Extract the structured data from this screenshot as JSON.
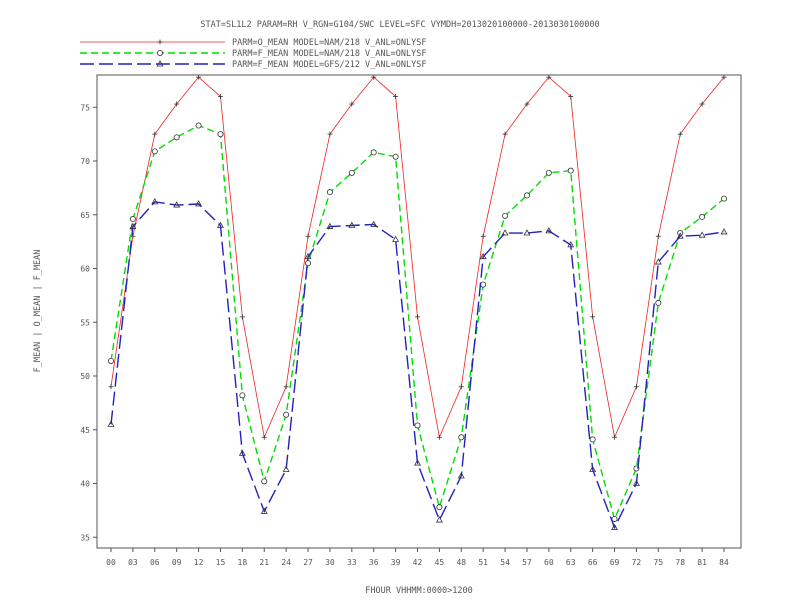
{
  "chart_data": {
    "type": "line",
    "title": "STAT=SL1L2 PARAM=RH V_RGN=G104/SWC LEVEL=SFC VYMDH=2013020100000-2013030100000",
    "xlabel": "FHOUR VHHMM:0000>1200",
    "ylabel": "F_MEAN | O_MEAN | F_MEAN",
    "legend_position": "top-left",
    "grid": false,
    "ylim": [
      34,
      78
    ],
    "yticks": [
      35,
      40,
      45,
      50,
      55,
      60,
      65,
      70,
      75
    ],
    "categories": [
      "00",
      "03",
      "06",
      "09",
      "12",
      "15",
      "18",
      "21",
      "24",
      "27",
      "30",
      "33",
      "36",
      "39",
      "42",
      "45",
      "48",
      "51",
      "54",
      "57",
      "60",
      "63",
      "66",
      "69",
      "72",
      "75",
      "78",
      "81",
      "84"
    ],
    "series": [
      {
        "name": "PARM=O_MEAN MODEL=NAM/218 V_ANL=ONLYSF",
        "color": "#ee2222",
        "dash": "solid",
        "marker": "plus",
        "values": [
          49.0,
          63.0,
          72.5,
          75.3,
          77.8,
          76.0,
          55.5,
          44.3,
          49.0,
          63.0,
          72.5,
          75.3,
          77.8,
          76.0,
          55.5,
          44.3,
          49.0,
          63.0,
          72.5,
          75.3,
          77.8,
          76.0,
          55.5,
          44.3,
          49.0,
          63.0,
          72.5,
          75.3,
          77.8
        ]
      },
      {
        "name": "PARM=F_MEAN MODEL=NAM/218 V_ANL=ONLYSF",
        "color": "#00dd00",
        "dash": "dashed",
        "marker": "circle",
        "values": [
          51.4,
          64.6,
          70.9,
          72.2,
          73.3,
          72.5,
          48.2,
          40.2,
          46.4,
          60.5,
          67.1,
          68.9,
          70.8,
          70.4,
          45.4,
          37.8,
          44.3,
          58.5,
          64.9,
          66.8,
          68.9,
          69.1,
          44.1,
          36.7,
          41.4,
          56.8,
          63.3,
          64.8,
          66.5
        ]
      },
      {
        "name": "PARM=F_MEAN MODEL=GFS/212 V_ANL=ONLYSF",
        "color": "#2222bb",
        "dash": "longdash",
        "marker": "triangle",
        "values": [
          45.5,
          63.9,
          66.2,
          65.9,
          66.0,
          64.0,
          42.8,
          37.4,
          41.3,
          61.1,
          63.9,
          64.0,
          64.1,
          62.7,
          41.9,
          36.6,
          40.7,
          61.1,
          63.3,
          63.3,
          63.5,
          62.2,
          41.3,
          35.9,
          40.0,
          60.6,
          63.0,
          63.1,
          63.4
        ]
      }
    ]
  }
}
